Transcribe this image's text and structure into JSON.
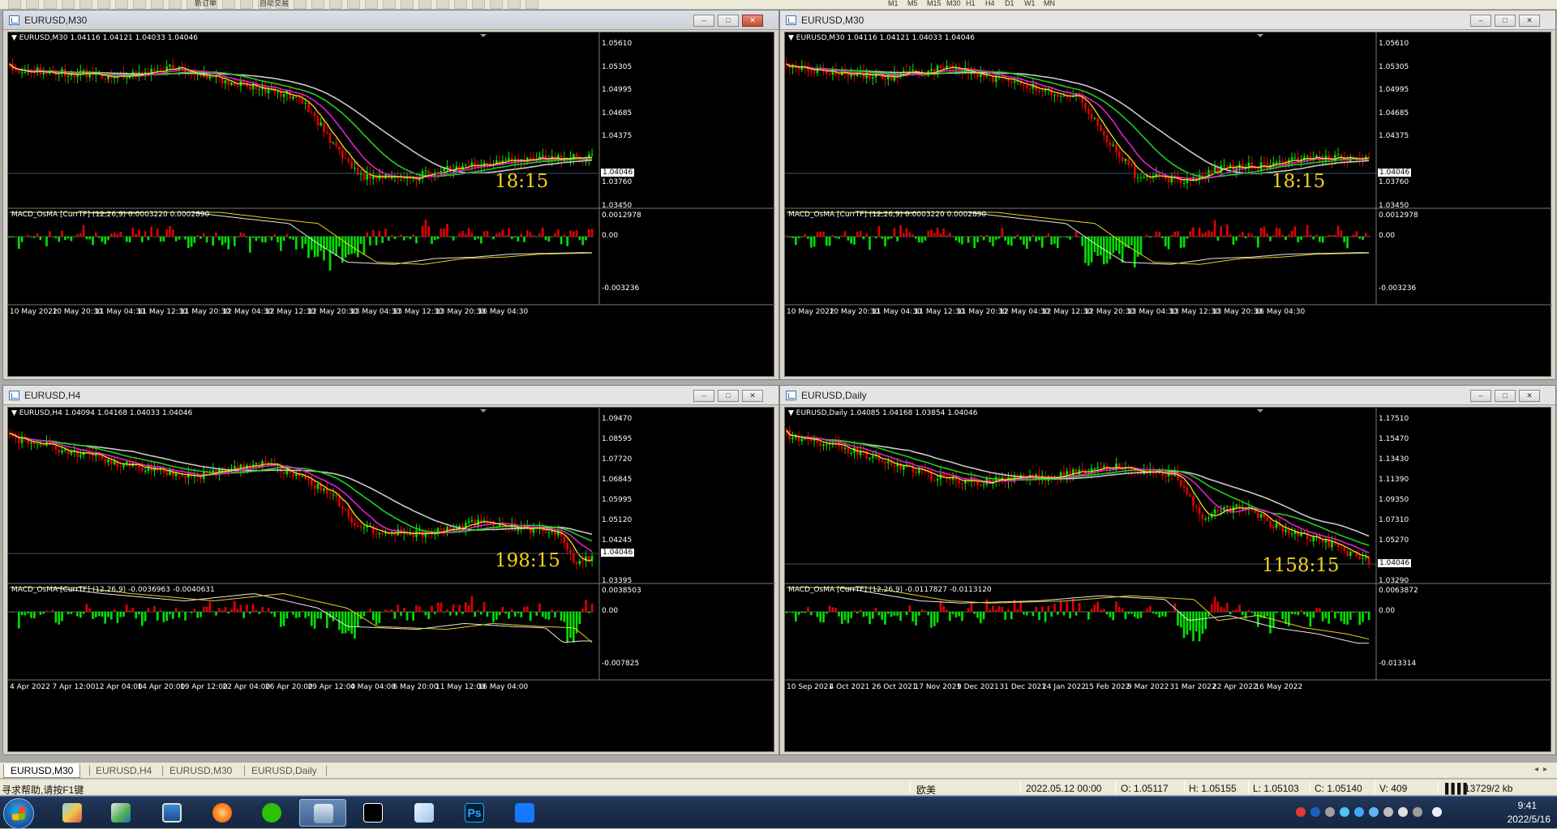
{
  "toolbar": {
    "items": [
      "新订单",
      "自动交易",
      "M1",
      "M5",
      "M15",
      "M30",
      "H1",
      "H4",
      "D1",
      "W1",
      "MN"
    ]
  },
  "charts": [
    {
      "id": "w1",
      "title": "EURUSD,M30",
      "header": "EURUSD,M30  1.04116 1.04121 1.04033 1.04046",
      "active": true,
      "price_ticks": [
        "1.05610",
        "1.05305",
        "1.04995",
        "1.04685",
        "1.04375",
        "1.04046",
        "1.03760",
        "1.03450"
      ],
      "price_tag": "1.04046",
      "countdown": "18:15",
      "macd_header": "MACD_OsMA [CurrTF] (12,26,9) 0.0003220 0.0002890",
      "macd_ticks": [
        "0.0012978",
        "0.00",
        "-0.003236"
      ],
      "time_ticks": [
        "10 May 2022",
        "10 May 20:30",
        "11 May 04:30",
        "11 May 12:30",
        "11 May 20:30",
        "12 May 04:30",
        "12 May 12:30",
        "12 May 20:30",
        "13 May 04:30",
        "13 May 12:30",
        "13 May 20:30",
        "16 May 04:30"
      ]
    },
    {
      "id": "w2",
      "title": "EURUSD,M30",
      "header": "EURUSD,M30  1.04116 1.04121 1.04033 1.04046",
      "active": false,
      "price_ticks": [
        "1.05610",
        "1.05305",
        "1.04995",
        "1.04685",
        "1.04375",
        "1.04046",
        "1.03760",
        "1.03450"
      ],
      "price_tag": "1.04046",
      "countdown": "18:15",
      "macd_header": "MACD_OsMA [CurrTF] (12,26,9) 0.0003220 0.0002890",
      "macd_ticks": [
        "0.0012978",
        "0.00",
        "-0.003236"
      ],
      "time_ticks": [
        "10 May 2022",
        "10 May 20:30",
        "11 May 04:30",
        "11 May 12:30",
        "11 May 20:30",
        "12 May 04:30",
        "12 May 12:30",
        "12 May 20:30",
        "13 May 04:30",
        "13 May 12:30",
        "13 May 20:30",
        "16 May 04:30"
      ]
    },
    {
      "id": "w3",
      "title": "EURUSD,H4",
      "header": "EURUSD,H4  1.04094 1.04168 1.04033 1.04046",
      "active": false,
      "price_ticks": [
        "1.09470",
        "1.08595",
        "1.07720",
        "1.06845",
        "1.05995",
        "1.05120",
        "1.04245",
        "1.04046",
        "1.03395"
      ],
      "price_tag": "1.04046",
      "countdown": "198:15",
      "macd_header": "MACD_OsMA [CurrTF] (12,26,9) -0.0036963 -0.0040631",
      "macd_ticks": [
        "0.0038503",
        "0.00",
        "-0.007825"
      ],
      "time_ticks": [
        "4 Apr 2022",
        "7 Apr 12:00",
        "12 Apr 04:00",
        "14 Apr 20:00",
        "19 Apr 12:00",
        "22 Apr 04:00",
        "26 Apr 20:00",
        "29 Apr 12:00",
        "4 May 04:00",
        "6 May 20:00",
        "11 May 12:00",
        "16 May 04:00"
      ]
    },
    {
      "id": "w4",
      "title": "EURUSD,Daily",
      "header": "EURUSD,Daily  1.04085 1.04168 1.03854 1.04046",
      "active": false,
      "price_ticks": [
        "1.17510",
        "1.15470",
        "1.13430",
        "1.11390",
        "1.09350",
        "1.07310",
        "1.05270",
        "1.04046",
        "1.03290"
      ],
      "price_tag": "1.04046",
      "countdown": "1158:15",
      "macd_header": "MACD_OsMA [CurrTF] (12,26,9) -0.0117827 -0.0113120",
      "macd_ticks": [
        "0.0063872",
        "0.00",
        "-0.013314"
      ],
      "time_ticks": [
        "10 Sep 2021",
        "4 Oct 2021",
        "26 Oct 2021",
        "17 Nov 2021",
        "9 Dec 2021",
        "31 Dec 2021",
        "24 Jan 2022",
        "15 Feb 2022",
        "9 Mar 2022",
        "31 Mar 2022",
        "22 Apr 2022",
        "16 May 2022"
      ]
    }
  ],
  "tabs": [
    "EURUSD,M30",
    "EURUSD,H4",
    "EURUSD,M30",
    "EURUSD,Daily"
  ],
  "status": {
    "help": "寻求帮助,请按F1键",
    "profile": "欧美",
    "datetime": "2022.05.12 00:00",
    "open": "O: 1.05117",
    "high": "H: 1.05155",
    "low": "L: 1.05103",
    "close": "C: 1.05140",
    "volume": "V: 409",
    "traffic": "13729/2 kb"
  },
  "taskbar": {
    "time": "9:41",
    "date": "2022/5/16"
  },
  "colors": {
    "bull": "#00e000",
    "bear": "#e00000",
    "ma_white": "#c8c8c8",
    "ma_green": "#22cc22",
    "ma_magenta": "#e020d0",
    "ma_yellow": "#f0e020",
    "countdown": "#f2d21a"
  }
}
